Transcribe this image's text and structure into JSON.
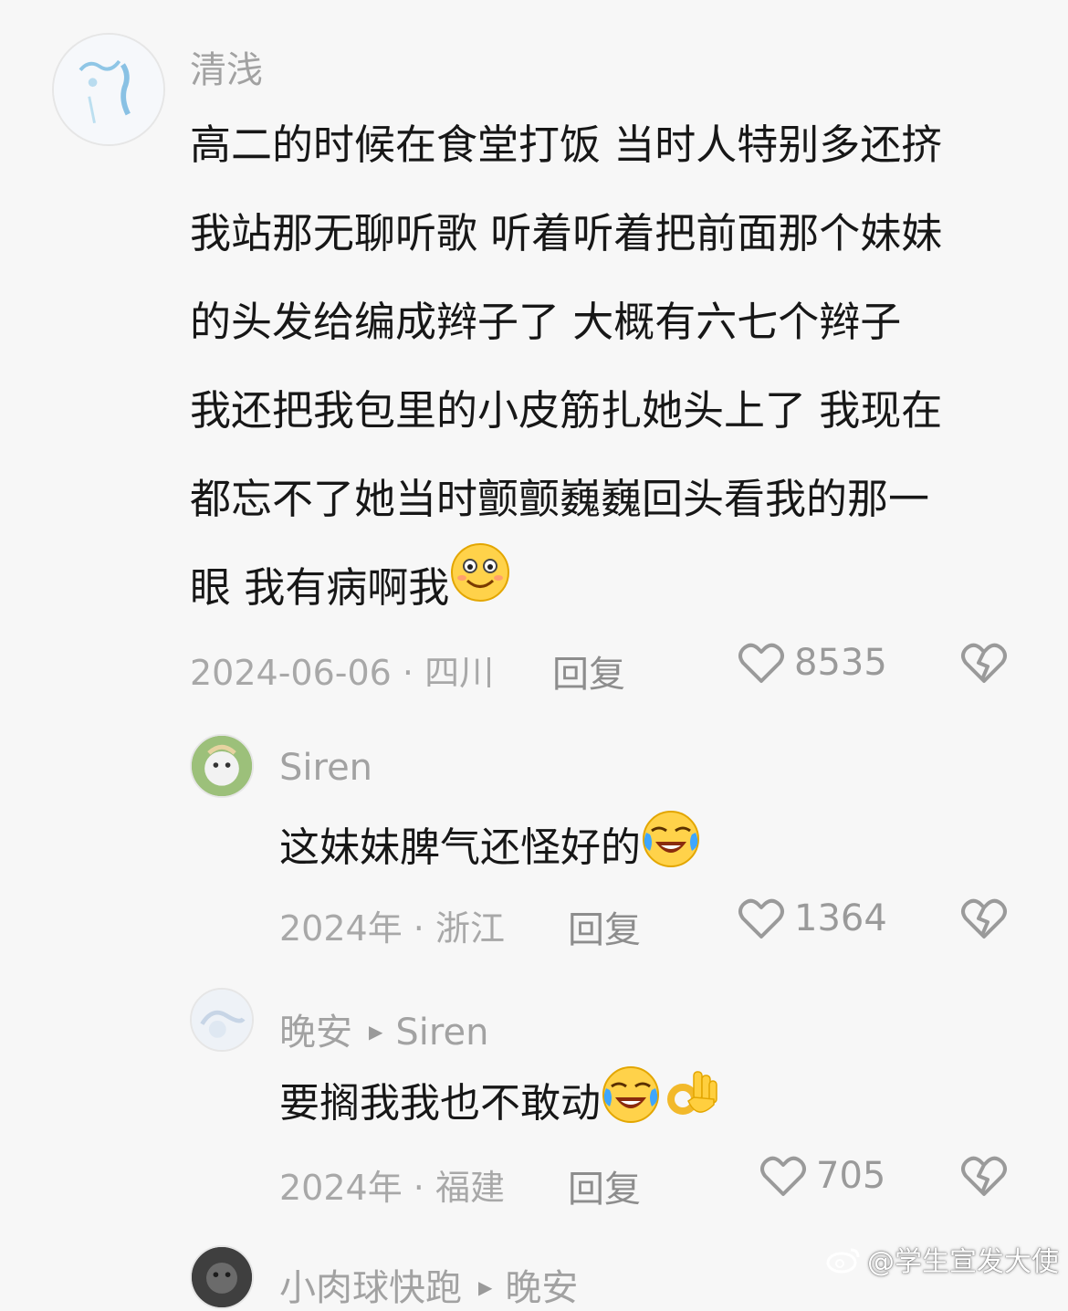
{
  "comments": [
    {
      "username": "清浅",
      "lines": [
        "高二的时候在食堂打饭 当时人特别多还挤",
        "我站那无聊听歌 听着听着把前面那个妹妹",
        "的头发给编成辫子了  大概有六七个辫子",
        "我还把我包里的小皮筋扎她头上了 我现在",
        "都忘不了她当时颤颤巍巍回头看我的那一",
        "眼 我有病啊我"
      ],
      "emoji": "smile-emoji",
      "date_location": "2024-06-06 · 四川",
      "reply_label": "回复",
      "likes": "8535"
    },
    {
      "username": "Siren",
      "text": "这妹妹脾气还怪好的",
      "emoji": "laugh-cry-emoji",
      "date_location": "2024年 · 浙江",
      "reply_label": "回复",
      "likes": "1364"
    },
    {
      "username": "晚安",
      "reply_to": "Siren",
      "text": "要搁我我也不敢动",
      "emoji": "laugh-cry-emoji, ok-hand-emoji",
      "date_location": "2024年 · 福建",
      "reply_label": "回复",
      "likes": "705"
    },
    {
      "username": "小肉球快跑",
      "reply_to": "晚安"
    }
  ],
  "watermark": "@学生宣发大使",
  "colors": {
    "background": "#f7f7f7",
    "meta": "#a8a8a8",
    "text": "#171717"
  }
}
